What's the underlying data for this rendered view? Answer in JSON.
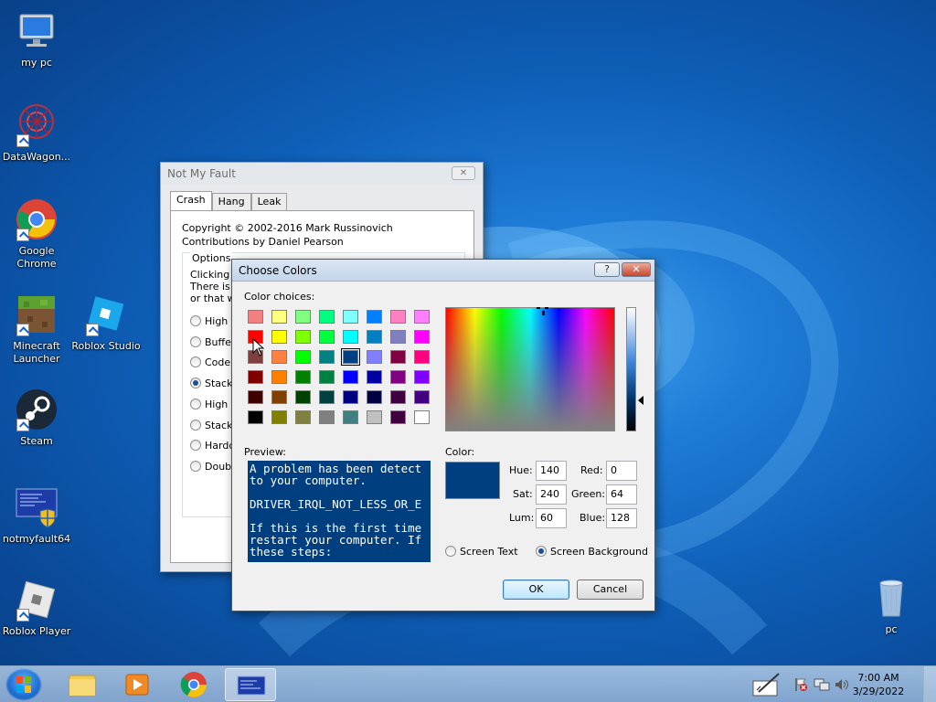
{
  "desktop": {
    "icons": [
      {
        "label": "my pc"
      },
      {
        "label": "DataWagon..."
      },
      {
        "label": "Google Chrome"
      },
      {
        "label": "Minecraft Launcher"
      },
      {
        "label": "Roblox Studio"
      },
      {
        "label": "Steam"
      },
      {
        "label": "notmyfault64"
      },
      {
        "label": "Roblox Player"
      },
      {
        "label": "pc"
      }
    ]
  },
  "notmyfault": {
    "title": "Not My Fault",
    "close_glyph": "✕",
    "tabs": [
      {
        "label": "Crash"
      },
      {
        "label": "Hang"
      },
      {
        "label": "Leak"
      }
    ],
    "copyright": "Copyright © 2002-2016 Mark Russinovich",
    "contributions": "Contributions by Daniel Pearson",
    "options_legend": "Options",
    "options_text": [
      "Clicking th",
      "There is a",
      "or that we"
    ],
    "radios": [
      {
        "label": "High I",
        "selected": false
      },
      {
        "label": "Buffer",
        "selected": false
      },
      {
        "label": "Code c",
        "selected": false
      },
      {
        "label": "Stack",
        "selected": true
      },
      {
        "label": "High I",
        "selected": false
      },
      {
        "label": "Stack",
        "selected": false
      },
      {
        "label": "Hardco",
        "selected": false
      },
      {
        "label": "Double",
        "selected": false
      }
    ]
  },
  "choose_colors": {
    "title": "Choose Colors",
    "help_glyph": "?",
    "close_glyph": "✕",
    "color_choices_label": "Color choices:",
    "swatches": [
      [
        "#f28080",
        "#ffff80",
        "#80ff80",
        "#00ff80",
        "#80ffff",
        "#0080ff",
        "#ff80c0",
        "#ff80ff"
      ],
      [
        "#ff0000",
        "#ffff00",
        "#80ff00",
        "#00ff40",
        "#00ffff",
        "#0080c0",
        "#8080c0",
        "#ff00ff"
      ],
      [
        "#804040",
        "#ff8040",
        "#00ff00",
        "#008080",
        "#004080",
        "#8080ff",
        "#800040",
        "#ff0080"
      ],
      [
        "#800000",
        "#ff8000",
        "#008000",
        "#008040",
        "#0000ff",
        "#0000a0",
        "#800080",
        "#8000ff"
      ],
      [
        "#400000",
        "#804000",
        "#004000",
        "#004040",
        "#000080",
        "#000040",
        "#400040",
        "#400080"
      ],
      [
        "#000000",
        "#808000",
        "#808040",
        "#808080",
        "#408080",
        "#c0c0c0",
        "#400040",
        "#ffffff"
      ]
    ],
    "selected_swatch": {
      "row": 2,
      "col": 4
    },
    "preview_label": "Preview:",
    "preview_text": "A problem has been detect\nto your computer.\n\nDRIVER_IRQL_NOT_LESS_OR_E\n\nIf this is the first time\nrestart your computer. If\nthese steps:",
    "color_label": "Color:",
    "current_color": "#003f7f",
    "hue_label": "Hue:",
    "hue": "140",
    "sat_label": "Sat:",
    "sat": "240",
    "lum_label": "Lum:",
    "lum": "60",
    "red_label": "Red:",
    "red": "0",
    "green_label": "Green:",
    "green": "64",
    "blue_label": "Blue:",
    "blue": "128",
    "screen_text_label": "Screen Text",
    "screen_background_label": "Screen Background",
    "ok_label": "OK",
    "cancel_label": "Cancel"
  },
  "taskbar": {
    "time": "7:00 AM",
    "date": "3/29/2022"
  }
}
